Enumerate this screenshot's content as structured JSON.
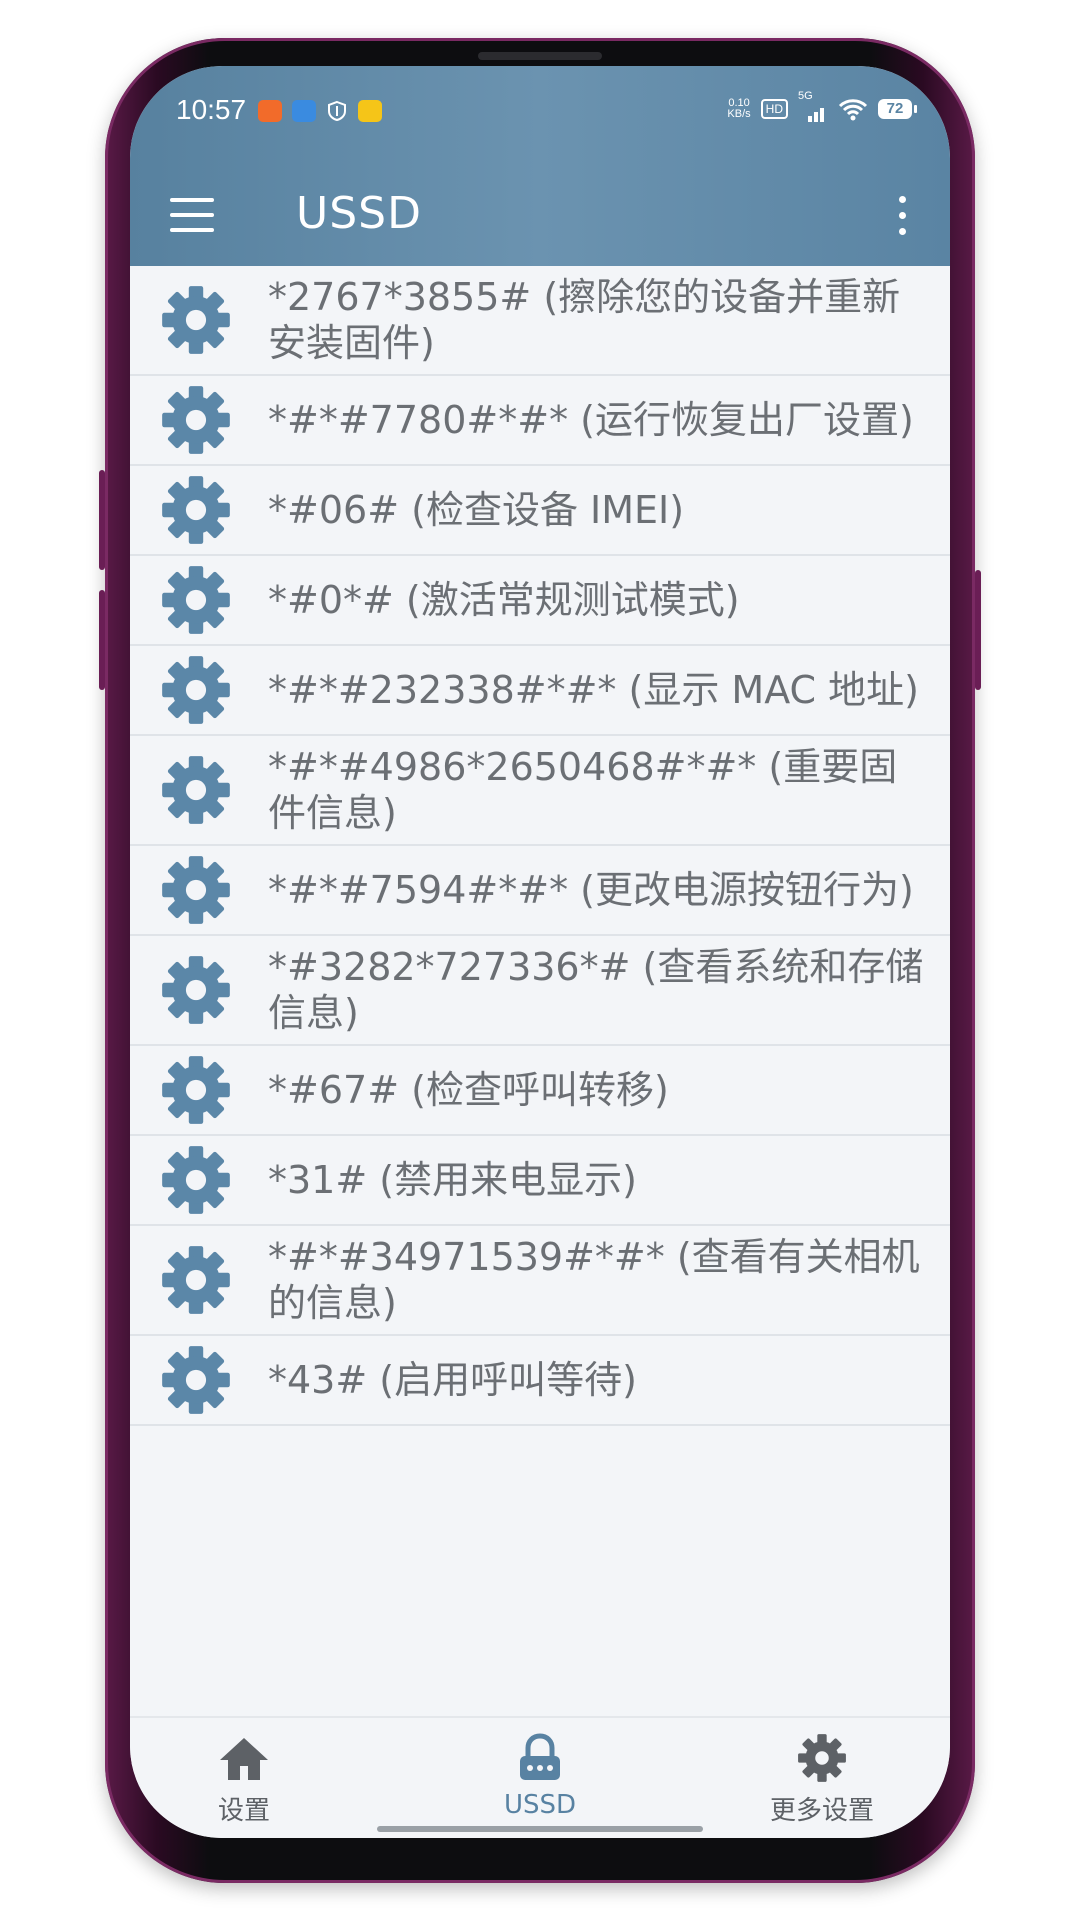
{
  "status_bar": {
    "time": "10:57",
    "net_speed_value": "0.10",
    "net_speed_unit": "KB/s",
    "hd": "HD",
    "network": "5G",
    "battery": "72"
  },
  "toolbar": {
    "title": "USSD"
  },
  "codes": [
    {
      "text": "*2767*3855# (擦除您的设备并重新安装固件)",
      "tall": true
    },
    {
      "text": "*#*#7780#*#* (运行恢复出厂设置)",
      "tall": false
    },
    {
      "text": "*#06# (检查设备 IMEI)",
      "tall": false
    },
    {
      "text": "*#0*# (激活常规测试模式)",
      "tall": false
    },
    {
      "text": "*#*#232338#*#* (显示 MAC 地址)",
      "tall": false
    },
    {
      "text": "*#*#4986*2650468#*#* (重要固件信息)",
      "tall": true
    },
    {
      "text": "*#*#7594#*#* (更改电源按钮行为)",
      "tall": false
    },
    {
      "text": "*#3282*727336*# (查看系统和存储信息)",
      "tall": true
    },
    {
      "text": "*#67# (检查呼叫转移)",
      "tall": false
    },
    {
      "text": "*31# (禁用来电显示)",
      "tall": false
    },
    {
      "text": "*#*#34971539#*#* (查看有关相机的信息)",
      "tall": true
    },
    {
      "text": "*43# (启用呼叫等待)",
      "tall": false
    }
  ],
  "bottom_nav": {
    "items": [
      {
        "label": "设置",
        "icon": "home-icon"
      },
      {
        "label": "USSD",
        "icon": "lock-icon",
        "active": true
      },
      {
        "label": "更多设置",
        "icon": "gear-icon"
      }
    ]
  },
  "colors": {
    "header": "#6b93b0",
    "accent": "#5882a2",
    "gear": "#5b87a8",
    "text": "#6b6f74",
    "background": "#f3f5f8"
  }
}
